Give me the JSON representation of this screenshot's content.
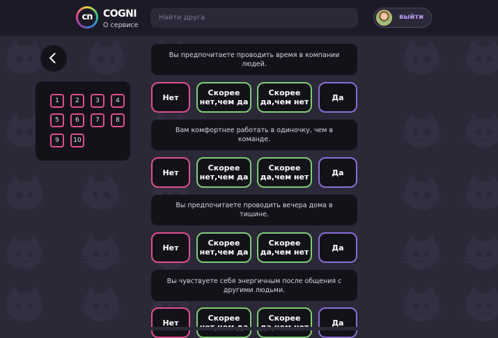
{
  "app": {
    "logo_text": "cn",
    "brand": "COGNI",
    "about_label": "О сервисе"
  },
  "search": {
    "placeholder": "Найти друга",
    "value": ""
  },
  "user": {
    "logout_label": "выйти"
  },
  "nav": {
    "back_icon": "chevron-left-icon",
    "question_numbers": [
      "1",
      "2",
      "3",
      "4",
      "5",
      "6",
      "7",
      "8",
      "9",
      "10"
    ]
  },
  "answer_options": {
    "no": "Нет",
    "rather_no": "Скорее нет,чем да",
    "rather_yes": "Скорее да,чем нет",
    "yes": "Да"
  },
  "questions": [
    {
      "text": "Вы предпочитаете проводить время в компании людей."
    },
    {
      "text": "Вам комфортнее работать в одиночку, чем в команде."
    },
    {
      "text": "Вы предпочитаете проводить вечера дома в тишине."
    },
    {
      "text": "Вы чувствуете себя энергичным после общения с другими людьми."
    }
  ],
  "colors": {
    "background": "#2b2838",
    "topbar": "#1c1a26",
    "card": "#141219",
    "no_border": "#e0508f",
    "rather_border": "#7fcf75",
    "yes_border": "#8a6fd8",
    "logout_text": "#b79cf2"
  }
}
